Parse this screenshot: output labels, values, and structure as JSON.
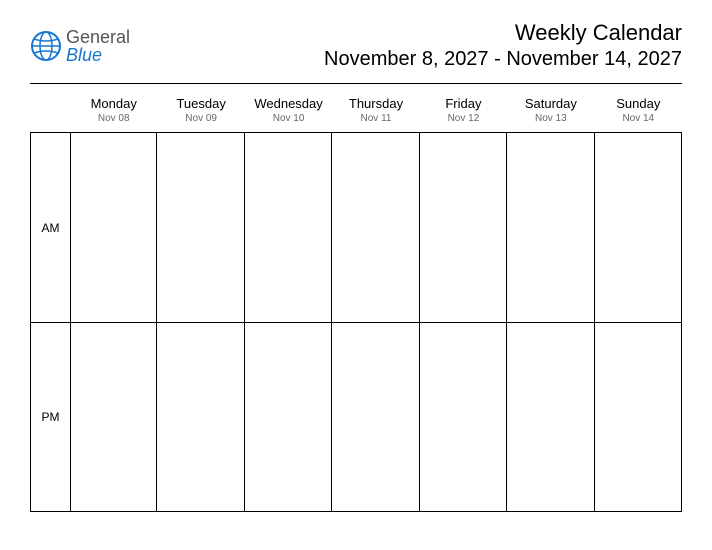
{
  "logo": {
    "general": "General",
    "blue": "Blue"
  },
  "header": {
    "title": "Weekly Calendar",
    "date_range": "November 8, 2027 - November 14, 2027"
  },
  "periods": {
    "am": "AM",
    "pm": "PM"
  },
  "days": [
    {
      "name": "Monday",
      "date": "Nov 08"
    },
    {
      "name": "Tuesday",
      "date": "Nov 09"
    },
    {
      "name": "Wednesday",
      "date": "Nov 10"
    },
    {
      "name": "Thursday",
      "date": "Nov 11"
    },
    {
      "name": "Friday",
      "date": "Nov 12"
    },
    {
      "name": "Saturday",
      "date": "Nov 13"
    },
    {
      "name": "Sunday",
      "date": "Nov 14"
    }
  ]
}
